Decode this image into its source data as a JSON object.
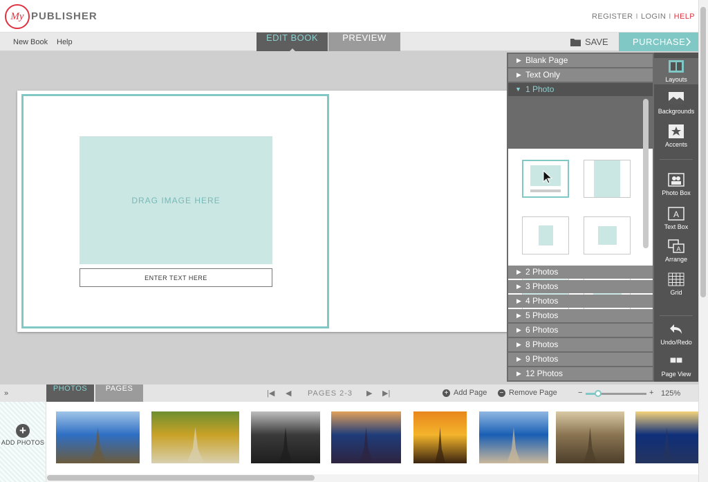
{
  "header": {
    "logo_text": "My",
    "brand": "PUBLISHER",
    "register": "REGISTER",
    "login": "LOGIN",
    "help": "HELP",
    "separator": "I"
  },
  "toolbar": {
    "menu": [
      "New Book",
      "Help"
    ],
    "tabs": {
      "edit": "EDIT BOOK",
      "preview": "PREVIEW"
    },
    "save": "SAVE",
    "purchase": "PURCHASE"
  },
  "canvas": {
    "photo_placeholder": "DRAG IMAGE HERE",
    "text_placeholder": "ENTER TEXT HERE"
  },
  "layout_panel": {
    "sections_top": [
      "Blank Page",
      "Text Only",
      "1 Photo"
    ],
    "open_section": "1 Photo",
    "sections_bottom": [
      "2 Photos",
      "3 Photos",
      "4 Photos",
      "5 Photos",
      "6 Photos",
      "8 Photos",
      "9 Photos",
      "12 Photos"
    ]
  },
  "tools": [
    {
      "label": "Layouts",
      "icon": "layouts-icon",
      "active": true
    },
    {
      "label": "Backgrounds",
      "icon": "backgrounds-icon"
    },
    {
      "label": "Accents",
      "icon": "accents-icon"
    },
    {
      "label": "Photo Box",
      "icon": "photo-box-icon"
    },
    {
      "label": "Text Box",
      "icon": "text-box-icon"
    },
    {
      "label": "Arrange",
      "icon": "arrange-icon"
    },
    {
      "label": "Grid",
      "icon": "grid-icon"
    },
    {
      "label": "Undo/Redo",
      "icon": "undo-icon"
    },
    {
      "label": "Page View",
      "icon": "page-view-icon"
    }
  ],
  "bottom_bar": {
    "tabs": {
      "photos": "PHOTOS",
      "pages": "PAGES"
    },
    "pages_range": "PAGES 2-3",
    "add_page": "Add Page",
    "remove_page": "Remove Page",
    "zoom": "125%",
    "zoom_fraction": 0.2
  },
  "tray": {
    "add_photos": "ADD PHOTOS",
    "photos": [
      {
        "name": "eiffel-tower-blue-sky",
        "colors": [
          "#2f6fc4",
          "#9fc4e8",
          "#6b5b3c"
        ]
      },
      {
        "name": "chateau-autumn-garden",
        "colors": [
          "#c9a227",
          "#6e8f2f",
          "#d8cfae"
        ]
      },
      {
        "name": "paris-street-signs-bw",
        "colors": [
          "#3a3a3a",
          "#bdbdbd",
          "#1e1e1e"
        ]
      },
      {
        "name": "louvre-pyramid-dusk",
        "colors": [
          "#1f3c7a",
          "#e2a05a",
          "#2e2440"
        ]
      },
      {
        "name": "eiffel-tower-sunset",
        "colors": [
          "#f4b42b",
          "#e8861c",
          "#3a2410"
        ]
      },
      {
        "name": "arc-de-triomphe-day",
        "colors": [
          "#1a5fb4",
          "#8fb7e2",
          "#c9b79a"
        ]
      },
      {
        "name": "palais-royal-arcade",
        "colors": [
          "#8a7452",
          "#d9c9a4",
          "#4d3f2b"
        ]
      },
      {
        "name": "arc-de-triomphe-night",
        "colors": [
          "#0f2f7a",
          "#f5d37a",
          "#24345f"
        ]
      }
    ]
  }
}
